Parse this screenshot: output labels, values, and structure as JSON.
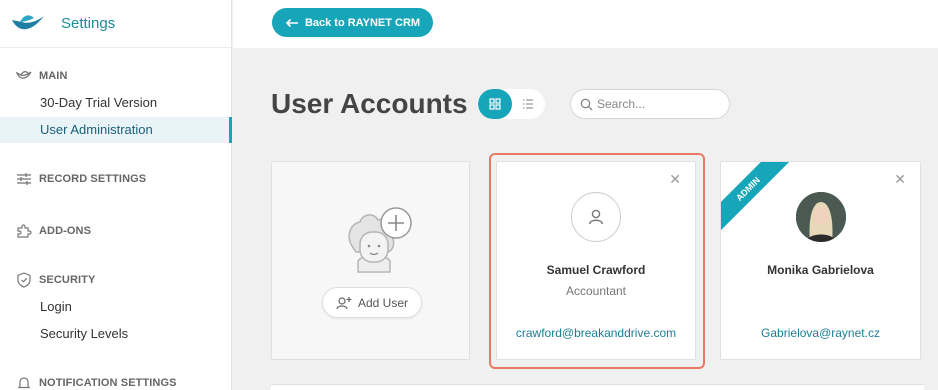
{
  "app": {
    "title": "Settings"
  },
  "sidebar": {
    "main_label": "MAIN",
    "main_items": [
      {
        "label": "30-Day Trial Version"
      },
      {
        "label": "User Administration"
      }
    ],
    "record_settings_label": "RECORD SETTINGS",
    "addons_label": "ADD-ONS",
    "security_label": "SECURITY",
    "security_items": [
      {
        "label": "Login"
      },
      {
        "label": "Security Levels"
      }
    ],
    "notification_label": "NOTIFICATION SETTINGS"
  },
  "toolbar": {
    "back_label": "Back to RAYNET CRM"
  },
  "page": {
    "title": "User Accounts"
  },
  "search": {
    "placeholder": "Search...",
    "value": ""
  },
  "add_card": {
    "button_label": "Add User"
  },
  "users": [
    {
      "name": "Samuel Crawford",
      "role": "Accountant",
      "email": "crawford@breakanddrive.com"
    },
    {
      "name": "Monika Gabrielova",
      "role": "",
      "email": "Gabrielova@raynet.cz",
      "badge": "ADMIN"
    }
  ],
  "colors": {
    "accent": "#17a5b9",
    "selection": "#e87a5f",
    "link": "#1b7f95"
  }
}
